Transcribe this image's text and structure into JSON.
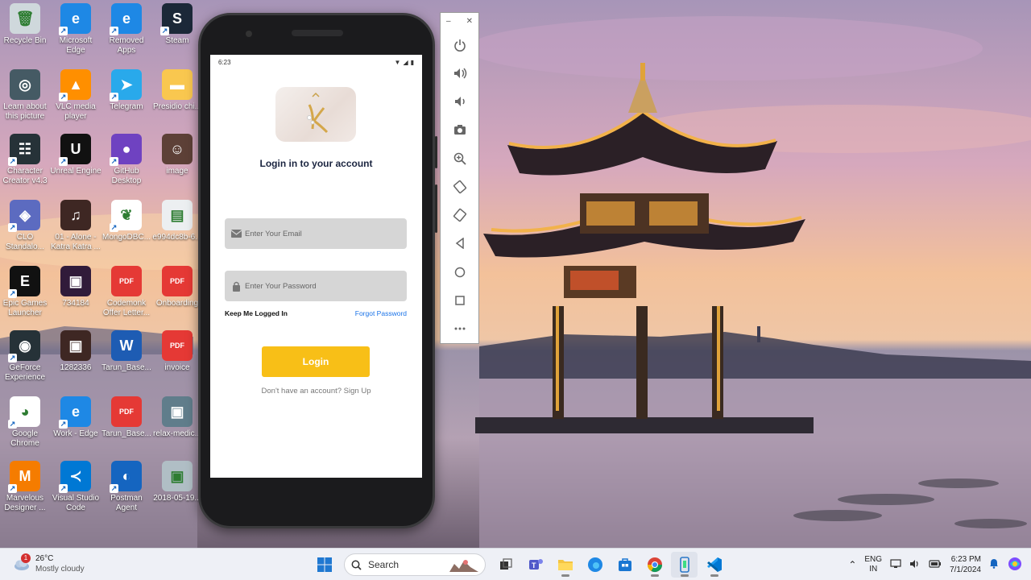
{
  "desktop": {
    "icons": [
      {
        "label": "Recycle Bin",
        "color": "#cfd8dc",
        "glyph": "🗑"
      },
      {
        "label": "Microsoft Edge",
        "color": "#1e88e5",
        "glyph": "e"
      },
      {
        "label": "Removed Apps",
        "color": "#1e88e5",
        "glyph": "e"
      },
      {
        "label": "Steam",
        "color": "#1b2838",
        "glyph": "S"
      },
      {
        "label": "Learn about this picture",
        "color": "#455a64",
        "glyph": "◎"
      },
      {
        "label": "VLC media player",
        "color": "#ff8f00",
        "glyph": "▲"
      },
      {
        "label": "Telegram",
        "color": "#29a9eb",
        "glyph": "➤"
      },
      {
        "label": "Presidio chi...",
        "color": "#f9c74f",
        "glyph": "▬"
      },
      {
        "label": "Character Creator v4.3",
        "color": "#263238",
        "glyph": "☷"
      },
      {
        "label": "Unreal Engine",
        "color": "#111111",
        "glyph": "U"
      },
      {
        "label": "GitHub Desktop",
        "color": "#6f42c1",
        "glyph": "●"
      },
      {
        "label": "image",
        "color": "#5d4037",
        "glyph": "☺"
      },
      {
        "label": "CLO Standalo...",
        "color": "#5c6bc0",
        "glyph": "◈"
      },
      {
        "label": "01 - Alone - Katra Katra ...",
        "color": "#3e2723",
        "glyph": "♫"
      },
      {
        "label": "MongoDBC...",
        "color": "#ffffff",
        "glyph": "❦"
      },
      {
        "label": "e994dc8b-6...",
        "color": "#eceff1",
        "glyph": "▤"
      },
      {
        "label": "Epic Games Launcher",
        "color": "#111111",
        "glyph": "E"
      },
      {
        "label": "734184",
        "color": "#311b3a",
        "glyph": "▣"
      },
      {
        "label": "Codemonk Offer Letter...",
        "color": "#e53935",
        "glyph": "PDF"
      },
      {
        "label": "Onboarding",
        "color": "#e53935",
        "glyph": "PDF"
      },
      {
        "label": "GeForce Experience",
        "color": "#263238",
        "glyph": "◉"
      },
      {
        "label": "1282336",
        "color": "#3e2723",
        "glyph": "▣"
      },
      {
        "label": "Tarun_Base...",
        "color": "#1e5cb3",
        "glyph": "W"
      },
      {
        "label": "invoice",
        "color": "#e53935",
        "glyph": "PDF"
      },
      {
        "label": "Google Chrome",
        "color": "#ffffff",
        "glyph": "◕"
      },
      {
        "label": "Work - Edge",
        "color": "#1e88e5",
        "glyph": "e"
      },
      {
        "label": "Tarun_Base...",
        "color": "#e53935",
        "glyph": "PDF"
      },
      {
        "label": "relax-medic...",
        "color": "#607d8b",
        "glyph": "▣"
      },
      {
        "label": "Marvelous Designer ...",
        "color": "#f57c00",
        "glyph": "M"
      },
      {
        "label": "Visual Studio Code",
        "color": "#0078d4",
        "glyph": "≺"
      },
      {
        "label": "Postman Agent",
        "color": "#1565c0",
        "glyph": "◐"
      },
      {
        "label": "2018-05-19...",
        "color": "#b0bec5",
        "glyph": "▣"
      }
    ]
  },
  "phone": {
    "status_time": "6:23",
    "title": "Login in to your account",
    "email_placeholder": "Enter Your Email",
    "password_placeholder": "Enter Your Password",
    "keep_logged_in": "Keep Me Logged In",
    "forgot_password": "Forgot Password",
    "login_button": "Login",
    "signup_prompt": "Don't have an account? Sign Up",
    "accent_color": "#f8bf17"
  },
  "emulator_toolbar": {
    "minimize": "–",
    "close": "✕",
    "buttons": [
      "power-icon",
      "volume-up-icon",
      "volume-down-icon",
      "camera-icon",
      "zoom-icon",
      "rotate-left-icon",
      "rotate-right-icon",
      "back-icon",
      "home-icon",
      "overview-icon",
      "more-icon"
    ]
  },
  "taskbar": {
    "weather_badge": "1",
    "temperature": "26°C",
    "condition": "Mostly cloudy",
    "search_label": "Search",
    "language_line1": "ENG",
    "language_line2": "IN",
    "time": "6:23 PM",
    "date": "7/1/2024"
  }
}
